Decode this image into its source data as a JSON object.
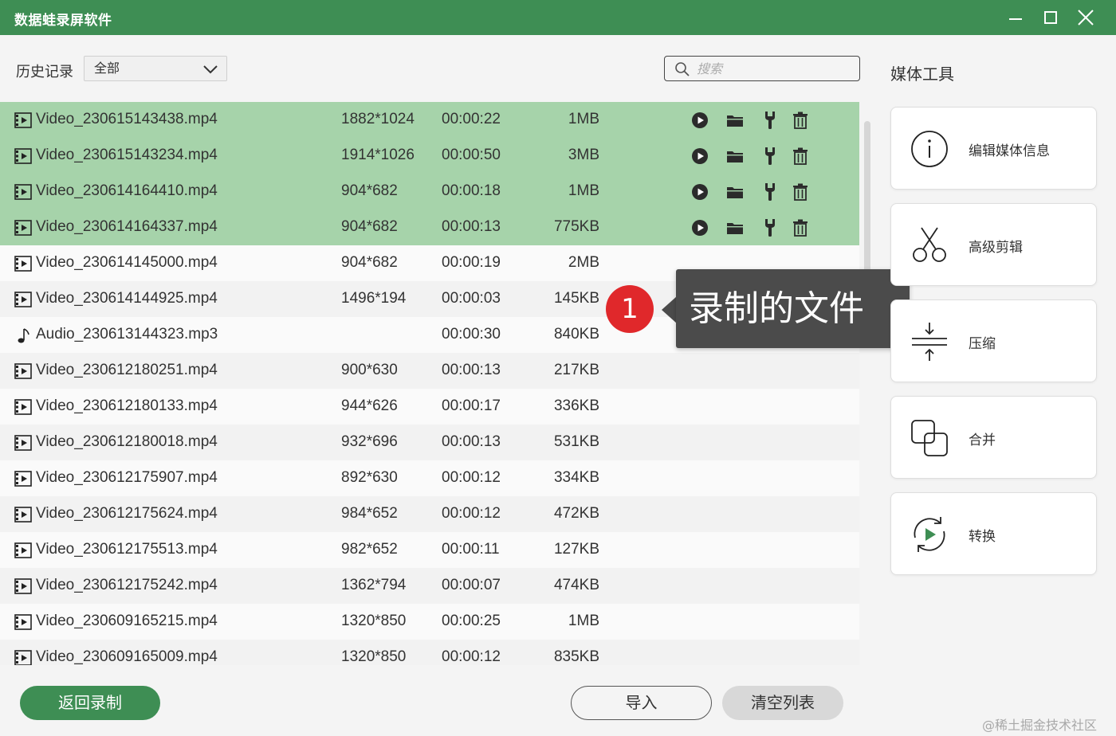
{
  "app": {
    "title": "数据蛙录屏软件",
    "window_controls": [
      "minimize-icon",
      "maximize-icon",
      "close-icon"
    ]
  },
  "filter": {
    "history_label": "历史记录",
    "history_selected": "全部",
    "search_placeholder": "搜索"
  },
  "media_tools": {
    "title": "媒体工具",
    "tools": [
      {
        "label": "编辑媒体信息",
        "icon": "info-icon"
      },
      {
        "label": "高级剪辑",
        "icon": "scissors-icon"
      },
      {
        "label": "压缩",
        "icon": "compress-icon"
      },
      {
        "label": "合并",
        "icon": "merge-icon"
      },
      {
        "label": "转换",
        "icon": "convert-icon"
      }
    ]
  },
  "files": [
    {
      "type": "video",
      "name": "Video_230615143438.mp4",
      "resolution": "1882*1024",
      "duration": "00:00:22",
      "size": "1MB",
      "selected": true
    },
    {
      "type": "video",
      "name": "Video_230615143234.mp4",
      "resolution": "1914*1026",
      "duration": "00:00:50",
      "size": "3MB",
      "selected": true
    },
    {
      "type": "video",
      "name": "Video_230614164410.mp4",
      "resolution": "904*682",
      "duration": "00:00:18",
      "size": "1MB",
      "selected": true
    },
    {
      "type": "video",
      "name": "Video_230614164337.mp4",
      "resolution": "904*682",
      "duration": "00:00:13",
      "size": "775KB",
      "selected": true
    },
    {
      "type": "video",
      "name": "Video_230614145000.mp4",
      "resolution": "904*682",
      "duration": "00:00:19",
      "size": "2MB",
      "selected": false
    },
    {
      "type": "video",
      "name": "Video_230614144925.mp4",
      "resolution": "1496*194",
      "duration": "00:00:03",
      "size": "145KB",
      "selected": false
    },
    {
      "type": "audio",
      "name": "Audio_230613144323.mp3",
      "resolution": "",
      "duration": "00:00:30",
      "size": "840KB",
      "selected": false
    },
    {
      "type": "video",
      "name": "Video_230612180251.mp4",
      "resolution": "900*630",
      "duration": "00:00:13",
      "size": "217KB",
      "selected": false
    },
    {
      "type": "video",
      "name": "Video_230612180133.mp4",
      "resolution": "944*626",
      "duration": "00:00:17",
      "size": "336KB",
      "selected": false
    },
    {
      "type": "video",
      "name": "Video_230612180018.mp4",
      "resolution": "932*696",
      "duration": "00:00:13",
      "size": "531KB",
      "selected": false
    },
    {
      "type": "video",
      "name": "Video_230612175907.mp4",
      "resolution": "892*630",
      "duration": "00:00:12",
      "size": "334KB",
      "selected": false
    },
    {
      "type": "video",
      "name": "Video_230612175624.mp4",
      "resolution": "984*652",
      "duration": "00:00:12",
      "size": "472KB",
      "selected": false
    },
    {
      "type": "video",
      "name": "Video_230612175513.mp4",
      "resolution": "982*652",
      "duration": "00:00:11",
      "size": "127KB",
      "selected": false
    },
    {
      "type": "video",
      "name": "Video_230612175242.mp4",
      "resolution": "1362*794",
      "duration": "00:00:07",
      "size": "474KB",
      "selected": false
    },
    {
      "type": "video",
      "name": "Video_230609165215.mp4",
      "resolution": "1320*850",
      "duration": "00:00:25",
      "size": "1MB",
      "selected": false
    },
    {
      "type": "video",
      "name": "Video_230609165009.mp4",
      "resolution": "1320*850",
      "duration": "00:00:12",
      "size": "835KB",
      "selected": false
    }
  ],
  "row_actions": [
    "play-icon",
    "folder-icon",
    "edit-tool-icon",
    "trash-icon"
  ],
  "callout": {
    "number": "1",
    "text": "录制的文件"
  },
  "footer": {
    "back_label": "返回录制",
    "import_label": "导入",
    "clear_label": "清空列表"
  },
  "watermark": "@稀土掘金技术社区",
  "colors": {
    "brand_green": "#3e8e54",
    "selected_row": "#a6d3aa",
    "callout_red": "#e0282b",
    "callout_bg": "#4b4b4b"
  }
}
